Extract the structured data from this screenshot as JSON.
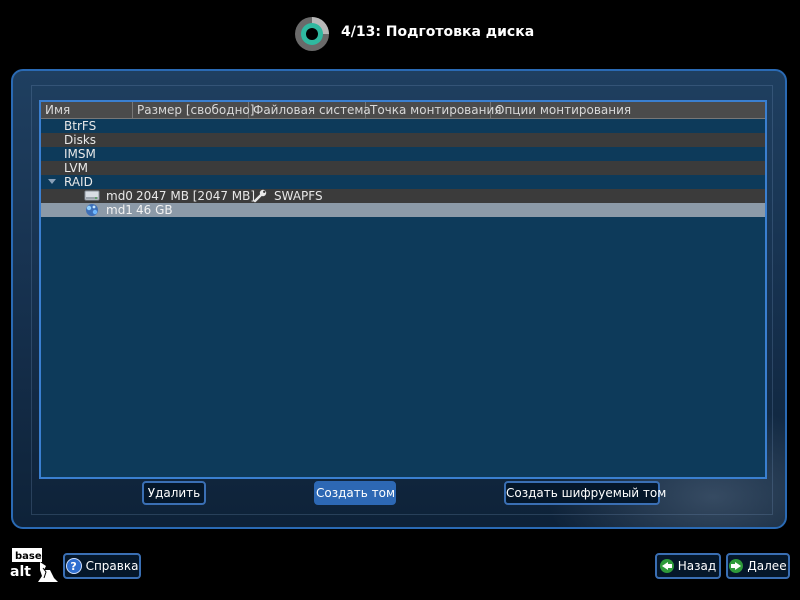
{
  "header": {
    "title": "4/13: Подготовка диска"
  },
  "columns": [
    "Имя",
    "Размер [свободно]",
    "Файловая система",
    "Точка монтирования",
    "Опции монтирования"
  ],
  "tree": {
    "groups": [
      {
        "label": "BtrFS"
      },
      {
        "label": "Disks"
      },
      {
        "label": "IMSM"
      },
      {
        "label": "LVM"
      },
      {
        "label": "RAID"
      }
    ],
    "raid_children": [
      {
        "name": "md0",
        "size": "2047 MB [2047 MB]",
        "fs": "SWAPFS"
      },
      {
        "name": "md1",
        "size": "46 GB",
        "fs": ""
      }
    ]
  },
  "buttons": {
    "delete": "Удалить",
    "create_volume": "Создать том",
    "create_encrypted": "Создать шифруемый том"
  },
  "footer": {
    "logo_top": "base",
    "logo_bottom": "alt",
    "help": "Справка",
    "back": "Назад",
    "next": "Далее"
  },
  "colors": {
    "accent": "#3a7fd0",
    "tree_bg": "#0d3a5a",
    "selected_row": "#8c9aa8",
    "logo_ring": "#2fb9a0"
  }
}
